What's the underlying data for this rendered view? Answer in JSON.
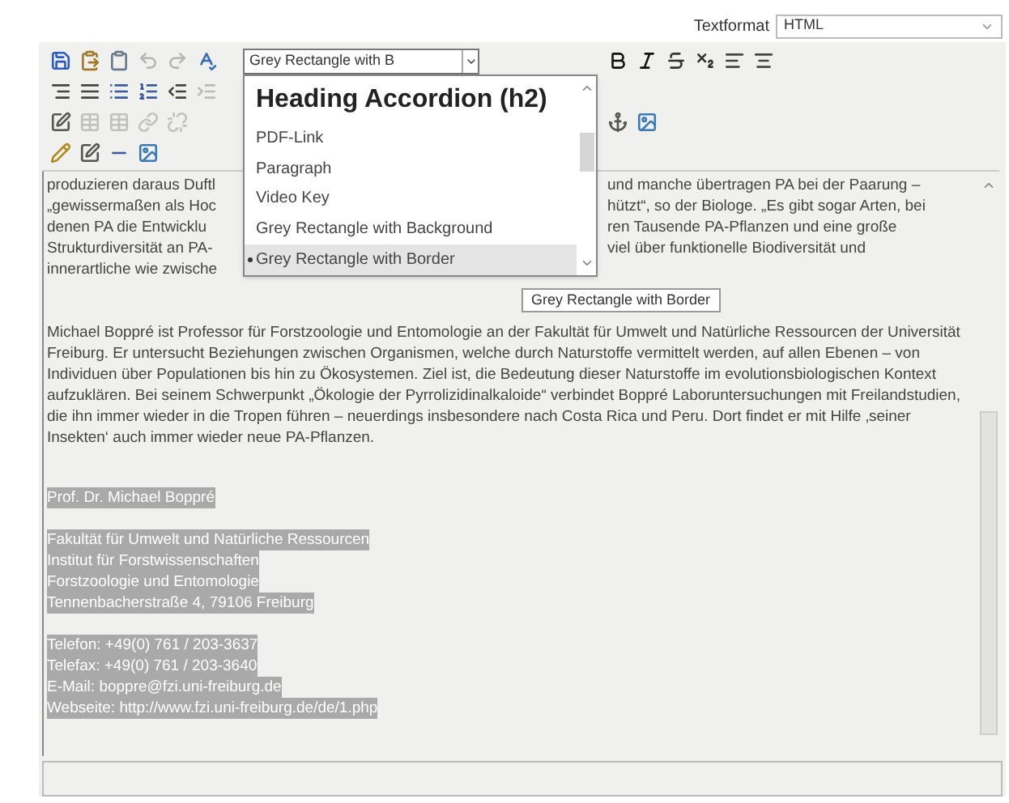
{
  "text_format": {
    "label": "Textformat",
    "value": "HTML"
  },
  "toolbar": [
    {
      "before": [
        {
          "kind": "save",
          "disabled": false
        },
        {
          "kind": "paste",
          "disabled": false
        },
        {
          "kind": "pasteword",
          "disabled": false
        },
        {
          "kind": "undo",
          "disabled": true
        },
        {
          "kind": "redo",
          "disabled": true
        },
        {
          "kind": "spellcheck",
          "disabled": false
        }
      ],
      "after": [
        {
          "kind": "bold",
          "disabled": false
        },
        {
          "kind": "italic",
          "disabled": false
        },
        {
          "kind": "strike",
          "disabled": false
        },
        {
          "kind": "subscript",
          "disabled": false
        },
        {
          "kind": "alignleft",
          "disabled": false
        },
        {
          "kind": "aligncenter",
          "disabled": false
        }
      ]
    },
    {
      "before": [
        {
          "kind": "alignright",
          "disabled": false
        },
        {
          "kind": "justify",
          "disabled": false
        },
        {
          "kind": "bullets",
          "disabled": false
        },
        {
          "kind": "numbers",
          "disabled": false
        },
        {
          "kind": "outdent",
          "disabled": false
        },
        {
          "kind": "indent",
          "disabled": true
        }
      ]
    },
    {
      "before": [
        {
          "kind": "edit",
          "disabled": false
        },
        {
          "kind": "table",
          "disabled": true
        },
        {
          "kind": "table",
          "disabled": true
        },
        {
          "kind": "link",
          "disabled": true
        },
        {
          "kind": "unlink",
          "disabled": true
        }
      ],
      "after": [
        {
          "kind": "anchor",
          "disabled": false
        },
        {
          "kind": "image",
          "disabled": false
        }
      ]
    },
    {
      "before": [
        {
          "kind": "pencil",
          "disabled": false
        },
        {
          "kind": "edit",
          "disabled": false
        },
        {
          "kind": "rule",
          "disabled": false
        },
        {
          "kind": "image",
          "disabled": false
        }
      ]
    }
  ],
  "style_select": {
    "value": "Grey Rectangle with B",
    "options": [
      {
        "label": "Heading Accordion (h2)",
        "kind": "heading",
        "selected": false
      },
      {
        "label": "PDF-Link",
        "kind": "plain",
        "selected": false
      },
      {
        "label": "Paragraph",
        "kind": "plain",
        "selected": false
      },
      {
        "label": "Video Key",
        "kind": "plain",
        "selected": false
      },
      {
        "label": "Grey Rectangle with Background",
        "kind": "plain",
        "selected": false
      },
      {
        "label": "Grey Rectangle with Border",
        "kind": "plain",
        "selected": true
      }
    ]
  },
  "tooltip": "Grey Rectangle with Border",
  "covered_lines": [
    {
      "left": "produzieren daraus Duftl",
      "right": "und manche übertragen PA bei der Paarung –"
    },
    {
      "left": "„gewissermaßen als Hoc",
      "right": "hützt“, so der Biologe. „Es gibt sogar Arten, bei"
    },
    {
      "left": "denen PA die Entwicklu",
      "right": "ren Tausende PA-Pflanzen und eine große"
    },
    {
      "left": "Strukturdiversität an PA-",
      "right": "viel über funktionelle Biodiversität und"
    },
    {
      "left": "innerartliche wie zwische"
    }
  ],
  "paragraph": "Michael Boppré ist Professor für Forstzoologie und Entomologie an der Fakultät für Umwelt und Natürliche Ressourcen der Universität Freiburg. Er untersucht Beziehungen zwischen Organismen, welche durch Naturstoffe vermittelt werden, auf allen Ebenen – von Individuen über Populationen bis hin zu Ökosystemen. Ziel ist, die Bedeutung dieser Naturstoffe im evolutionsbiologischen Kontext aufzuklären. Bei seinem Schwerpunkt „Ökologie der Pyrrolizidinalkaloide“ verbindet Boppré Laboruntersuchungen mit Freilandstudien, die ihn immer wieder in die Tropen führen – neuerdings insbesondere nach Costa Rica und Peru. Dort findet er mit Hilfe ‚seiner Insekten‘ auch immer wieder neue PA-Pflanzen.",
  "contact_blocks": [
    [
      "Prof. Dr. Michael Boppré"
    ],
    [
      "Fakultät für Umwelt und Natürliche Ressourcen",
      "Institut für Forstwissenschaften",
      "Forstzoologie und Entomologie",
      "Tennenbacherstraße 4, 79106 Freiburg"
    ],
    [
      "Telefon: +49(0) 761 / 203-3637",
      "Telefax: +49(0) 761 / 203-3640",
      "E-Mail: boppre@fzi.uni-freiburg.de",
      "Webseite: http://www.fzi.uni-freiburg.de/de/1.php"
    ]
  ]
}
